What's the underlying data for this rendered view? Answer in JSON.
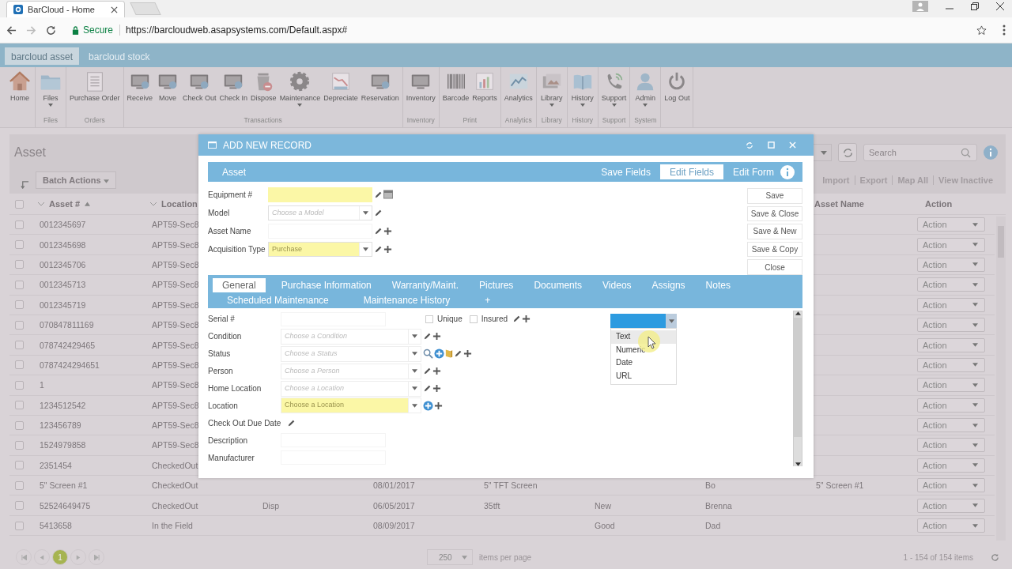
{
  "browser": {
    "tab_title": "BarCloud - Home",
    "secure_label": "Secure",
    "url": "https://barcloudweb.asapsystems.com/Default.aspx#"
  },
  "app_tabs": [
    {
      "label": "barcloud asset",
      "selected": true
    },
    {
      "label": "barcloud stock",
      "selected": false
    }
  ],
  "ribbon": [
    {
      "items": [
        {
          "label": "Home",
          "menu": false
        }
      ]
    },
    {
      "label": "Files",
      "items": [
        {
          "label": "Files",
          "menu": true
        }
      ]
    },
    {
      "label": "Orders",
      "items": [
        {
          "label": "Purchase Order",
          "menu": false
        }
      ]
    },
    {
      "label": "Transactions",
      "items": [
        {
          "label": "Receive",
          "menu": false
        },
        {
          "label": "Move",
          "menu": false
        },
        {
          "label": "Check Out",
          "menu": false
        },
        {
          "label": "Check In",
          "menu": false
        },
        {
          "label": "Dispose",
          "menu": false
        },
        {
          "label": "Maintenance",
          "menu": true
        },
        {
          "label": "Depreciate",
          "menu": false
        },
        {
          "label": "Reservation",
          "menu": false
        }
      ]
    },
    {
      "label": "Inventory",
      "items": [
        {
          "label": "Inventory",
          "menu": false
        }
      ]
    },
    {
      "label": "Print",
      "items": [
        {
          "label": "Barcode",
          "menu": false
        },
        {
          "label": "Reports",
          "menu": false
        }
      ]
    },
    {
      "label": "Analytics",
      "items": [
        {
          "label": "Analytics",
          "menu": false
        }
      ]
    },
    {
      "label": "Library",
      "items": [
        {
          "label": "Library",
          "menu": true
        }
      ]
    },
    {
      "label": "History",
      "items": [
        {
          "label": "History",
          "menu": true
        }
      ]
    },
    {
      "label": "Support",
      "items": [
        {
          "label": "Support",
          "menu": true
        }
      ]
    },
    {
      "label": "System",
      "items": [
        {
          "label": "Admin",
          "menu": true
        }
      ]
    },
    {
      "items": [
        {
          "label": "Log Out",
          "menu": false
        }
      ]
    }
  ],
  "page": {
    "title": "Asset",
    "batch_actions": "Batch Actions",
    "search": {
      "placeholder": "Search"
    },
    "links": [
      "Import",
      "Export",
      "Map All",
      "View Inactive"
    ]
  },
  "table": {
    "select_all_checked": false,
    "columns": [
      {
        "label": "Asset #",
        "filter": true,
        "sorted": true
      },
      {
        "label": "Location",
        "filter": true,
        "sorted": false
      },
      {
        "label": "Asset Name",
        "filter": false,
        "sorted": false
      },
      {
        "label": "Action",
        "filter": false,
        "sorted": false
      }
    ],
    "rows": [
      {
        "checked": false,
        "asset_no": "0012345697",
        "location": "APT59-Sec8",
        "action": "Action"
      },
      {
        "checked": false,
        "asset_no": "0012345698",
        "location": "APT59-Sec8",
        "action": "Action"
      },
      {
        "checked": false,
        "asset_no": "0012345706",
        "location": "APT59-Sec8",
        "action": "Action"
      },
      {
        "checked": false,
        "asset_no": "0012345713",
        "location": "APT59-Sec8",
        "action": "Action"
      },
      {
        "checked": false,
        "asset_no": "0012345719",
        "location": "APT59-Sec8",
        "action": "Action"
      },
      {
        "checked": false,
        "asset_no": "070847811169",
        "location": "APT59-Sec8",
        "action": "Action"
      },
      {
        "checked": false,
        "asset_no": "078742429465",
        "location": "APT59-Sec8",
        "action": "Action"
      },
      {
        "checked": false,
        "asset_no": "0787424294651",
        "location": "APT59-Sec8",
        "action": "Action"
      },
      {
        "checked": false,
        "asset_no": "1",
        "location": "APT59-Sec8",
        "action": "Action"
      },
      {
        "checked": false,
        "asset_no": "1234512542",
        "location": "APT59-Sec8",
        "action": "Action"
      },
      {
        "checked": false,
        "asset_no": "123456789",
        "location": "APT59-Sec8",
        "action": "Action"
      },
      {
        "checked": false,
        "asset_no": "1524979858",
        "location": "APT59-Sec8",
        "action": "Action"
      },
      {
        "checked": false,
        "asset_no": "2351454",
        "location": "CheckedOut",
        "action": "Action"
      },
      {
        "checked": false,
        "asset_no": "5\" Screen #1",
        "location": "CheckedOut",
        "column_4": "08/01/2017",
        "column_5": "5\" TFT Screen",
        "column_7": "Bo",
        "asset_name": "5\" Screen #1",
        "action": "Action"
      },
      {
        "checked": false,
        "asset_no": "52524649475",
        "location": "CheckedOut",
        "column_3": "Disp",
        "column_4": "06/05/2017",
        "column_5": "35tft",
        "column_6": "New",
        "column_7": "Brenna",
        "action": "Action"
      },
      {
        "checked": false,
        "asset_no": "5413658",
        "location": "In the Field",
        "column_4": "08/09/2017",
        "column_6": "Good",
        "column_7": "Dad",
        "action": "Action"
      }
    ]
  },
  "pager": {
    "pages": [
      {
        "label": "1",
        "selected": true
      }
    ],
    "page_size": "250",
    "page_size_label": "items per page",
    "summary": "1 - 154 of 154 items"
  },
  "modal": {
    "title": "ADD NEW RECORD",
    "section": "Asset",
    "header_actions": [
      {
        "label": "Save Fields",
        "selected": false
      },
      {
        "label": "Edit Fields",
        "selected": true
      },
      {
        "label": "Edit Form",
        "selected": false
      }
    ],
    "top_fields": [
      {
        "label": "Equipment #",
        "kind": "input",
        "required": true
      },
      {
        "label": "Model",
        "kind": "select",
        "placeholder": "Choose a Model",
        "required": false
      },
      {
        "label": "Asset Name",
        "kind": "input",
        "required": false
      },
      {
        "label": "Acquisition Type",
        "kind": "select",
        "placeholder": "Purchase",
        "required": true
      }
    ],
    "side_buttons": [
      "Save",
      "Save & Close",
      "Save & New",
      "Save & Copy",
      "Close"
    ],
    "tab_rows": [
      [
        {
          "label": "General",
          "selected": true
        },
        {
          "label": "Purchase Information",
          "selected": false
        },
        {
          "label": "Warranty/Maint.",
          "selected": false
        },
        {
          "label": "Pictures",
          "selected": false
        },
        {
          "label": "Documents",
          "selected": false
        },
        {
          "label": "Videos",
          "selected": false
        },
        {
          "label": "Assigns",
          "selected": false
        },
        {
          "label": "Notes",
          "selected": false
        }
      ],
      [
        {
          "label": "Scheduled Maintenance",
          "selected": false
        },
        {
          "label": "Maintenance History",
          "selected": false
        },
        {
          "label": "+",
          "selected": false
        }
      ]
    ],
    "fields": [
      {
        "label": "Serial #",
        "kind": "input",
        "checkboxes": [
          {
            "label": "Unique",
            "checked": false
          },
          {
            "label": "Insured",
            "checked": false
          }
        ]
      },
      {
        "label": "Condition",
        "kind": "select",
        "placeholder": "Choose a Condition"
      },
      {
        "label": "Status",
        "kind": "select",
        "placeholder": "Choose a Status"
      },
      {
        "label": "Person",
        "kind": "select",
        "placeholder": "Choose a Person"
      },
      {
        "label": "Home Location",
        "kind": "select",
        "placeholder": "Choose a Location"
      },
      {
        "label": "Location",
        "kind": "select",
        "placeholder": "Choose a Location",
        "required": true
      },
      {
        "label": "Check Out Due Date",
        "kind": "label"
      },
      {
        "label": "Description",
        "kind": "input"
      },
      {
        "label": "Manufacturer",
        "kind": "input"
      }
    ],
    "type_dropdown": {
      "options": [
        {
          "label": "Text",
          "selected": true
        },
        {
          "label": "Numeric",
          "selected": false
        },
        {
          "label": "Date",
          "selected": false
        },
        {
          "label": "URL",
          "selected": false
        }
      ]
    }
  }
}
